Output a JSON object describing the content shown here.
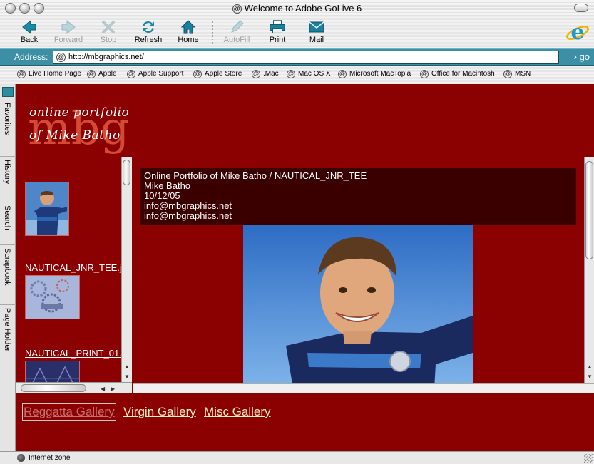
{
  "window": {
    "title": "Welcome to Adobe GoLive 6"
  },
  "toolbar": {
    "back": "Back",
    "forward": "Forward",
    "stop": "Stop",
    "refresh": "Refresh",
    "home": "Home",
    "autofill": "AutoFill",
    "print": "Print",
    "mail": "Mail"
  },
  "address": {
    "label": "Address:",
    "url": "http://mbgraphics.net/",
    "go": "go"
  },
  "favorites": [
    "Live Home Page",
    "Apple",
    "Apple Support",
    "Apple Store",
    ".Mac",
    "Mac OS X",
    "Microsoft MacTopia",
    "Office for Macintosh",
    "MSN"
  ],
  "sidetabs": [
    "Favorites",
    "History",
    "Search",
    "Scrapbook",
    "Page Holder"
  ],
  "logo": {
    "line1": "online portfolio",
    "line2": "of Mike Batho",
    "mark": "mbg"
  },
  "thumbnails": [
    {
      "label": "NAUTICAL_JNR_TEE.j"
    },
    {
      "label": "NAUTICAL_PRINT_01."
    },
    {
      "label": ""
    }
  ],
  "info": {
    "title": "Online Portfolio of Mike Batho / NAUTICAL_JNR_TEE",
    "author": "Mike Batho",
    "date": "10/12/05",
    "email": "info@mbgraphics.net",
    "email_link": "info@mbgraphics.net"
  },
  "galleries": [
    "Reggatta Gallery",
    "Virgin Gallery",
    "Misc Gallery"
  ],
  "status": {
    "zone": "Internet zone"
  },
  "colors": {
    "page_bg": "#8b0000",
    "info_bg": "#3a0000",
    "address_bar": "#3d8fa6",
    "link": "#f5f0c0"
  }
}
